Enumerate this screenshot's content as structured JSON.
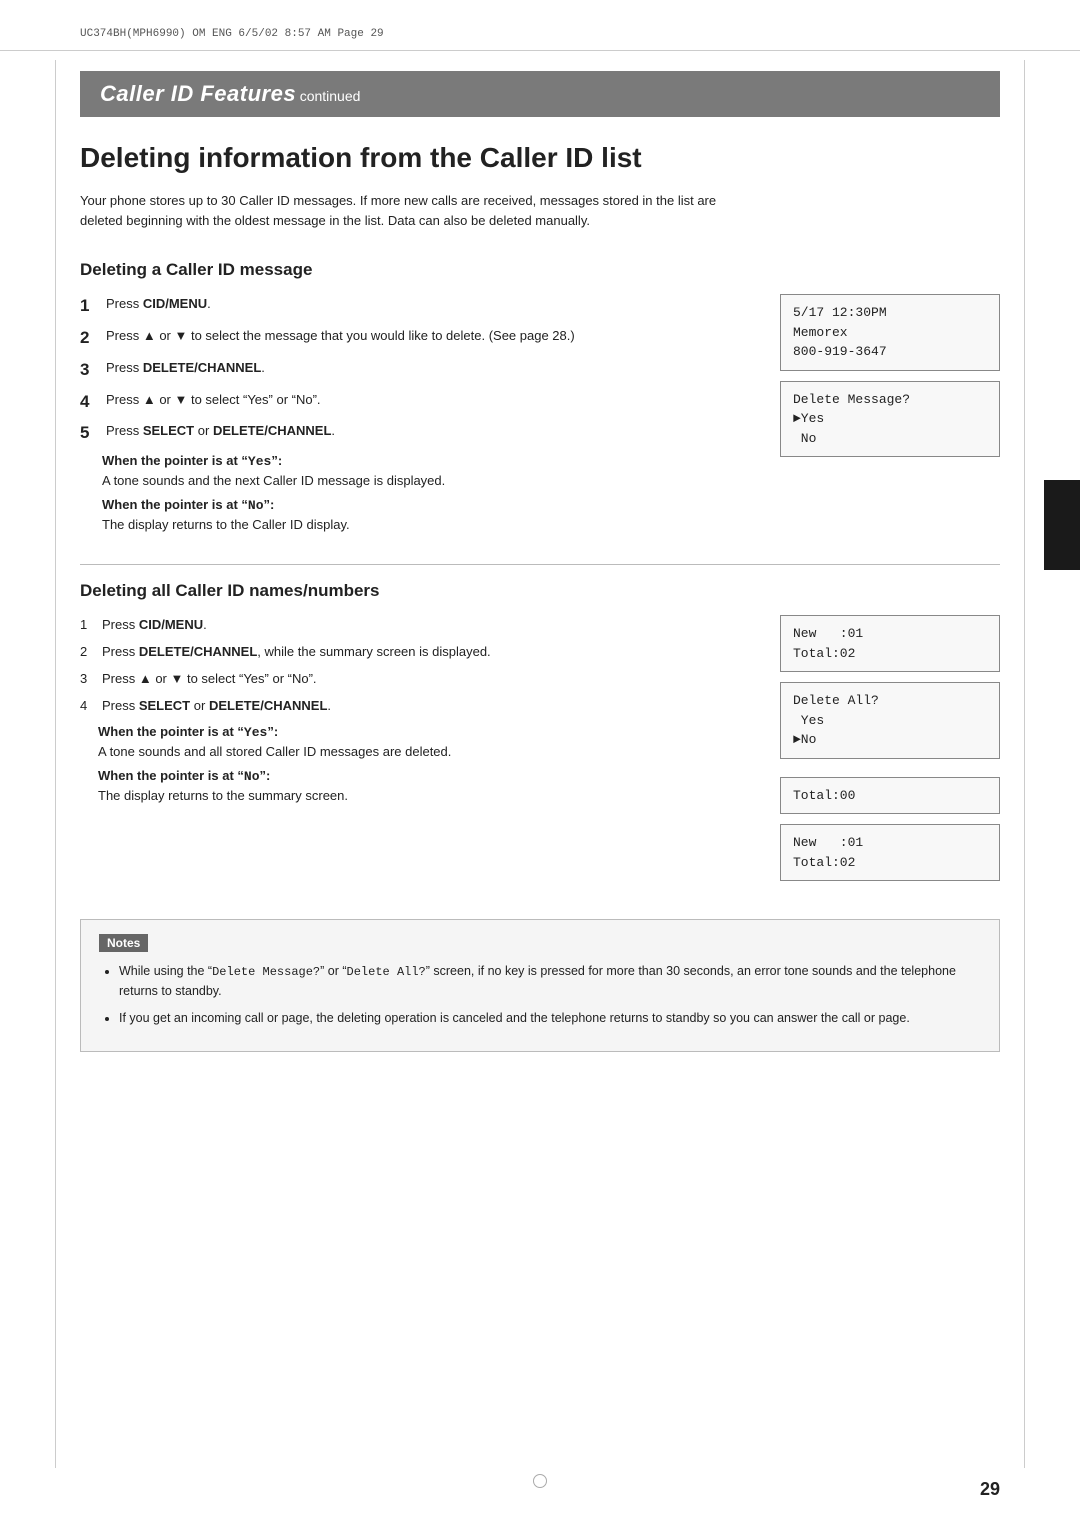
{
  "header": {
    "meta_line": "UC374BH(MPH6990)  OM ENG   6/5/02   8:57 AM   Page  29"
  },
  "section_header": {
    "main_title": "Caller ID Features",
    "continued": "continued"
  },
  "page_title": "Deleting information from the Caller ID list",
  "intro": "Your phone stores up to 30 Caller ID messages. If more new calls are received, messages stored in the list are deleted beginning with the oldest message in the list. Data can also be deleted manually.",
  "subsection1": {
    "title": "Deleting a Caller ID message",
    "steps": [
      {
        "num": "1",
        "bold": true,
        "text": "Press ",
        "key": "CID/MENU",
        "rest": "."
      },
      {
        "num": "2",
        "bold": true,
        "text": "Press ▲ or ▼ to select the message that you would like to delete. (See page 28.)"
      },
      {
        "num": "3",
        "bold": true,
        "text": "Press ",
        "key": "DELETE/CHANNEL",
        "rest": "."
      },
      {
        "num": "4",
        "bold": true,
        "text": "Press ▲ or ▼ to select “Yes” or “No”."
      },
      {
        "num": "5",
        "bold": true,
        "text": "Press ",
        "key": "SELECT",
        "rest": " or ",
        "key2": "DELETE/CHANNEL",
        "rest2": "."
      }
    ],
    "screen1": "5/17 12:30PM\nMemorex\n800-919-3647",
    "screen2": "Delete Message?\n►Yes\n No",
    "when_yes_title": "When the pointer is at “Yes”:",
    "when_yes_desc": "A tone sounds and the next Caller ID message is displayed.",
    "when_no_title": "When the pointer is at “No”:",
    "when_no_desc": "The display returns to the Caller ID display."
  },
  "subsection2": {
    "title": "Deleting all Caller ID names/numbers",
    "steps": [
      {
        "num": "1",
        "text": "Press ",
        "key": "CID/MENU",
        "rest": "."
      },
      {
        "num": "2",
        "text": "Press ",
        "key": "DELETE/CHANNEL",
        "rest": ", while the summary screen is displayed."
      },
      {
        "num": "3",
        "text": "Press ▲ or ▼ to select “Yes” or “No”."
      },
      {
        "num": "4",
        "text": "Press ",
        "key": "SELECT",
        "rest": " or ",
        "key2": "DELETE/CHANNEL",
        "rest2": "."
      }
    ],
    "screen1": "New   :01\nTotal:02",
    "screen2": "Delete All?\n Yes\n►No",
    "screen3": "Total:00",
    "screen4": "New   :01\nTotal:02",
    "when_yes_title": "When the pointer is at “Yes”:",
    "when_yes_desc": "A tone sounds and all stored Caller ID messages are deleted.",
    "when_no_title": "When the pointer is at “No”:",
    "when_no_desc": "The display returns to the summary screen."
  },
  "notes": {
    "label": "Notes",
    "items": [
      "While using the “Delete Message?” or “Delete All?” screen, if no key is pressed for more than 30 seconds, an error tone sounds and the telephone returns to standby.",
      "If you get an incoming call or page, the deleting operation is canceled and the telephone returns to standby so you can answer the call or page."
    ],
    "items_code": [
      {
        "prefix": "While using the “",
        "code1": "Delete Message?",
        "middle": "” or “",
        "code2": "Delete All?",
        "suffix": "” screen, if no key is pressed for more than 30 seconds, an error tone sounds and the telephone returns to standby."
      },
      {
        "text": "If you get an incoming call or page, the deleting operation is canceled and the telephone returns to standby so you can answer the call or page."
      }
    ]
  },
  "page_number": "29"
}
